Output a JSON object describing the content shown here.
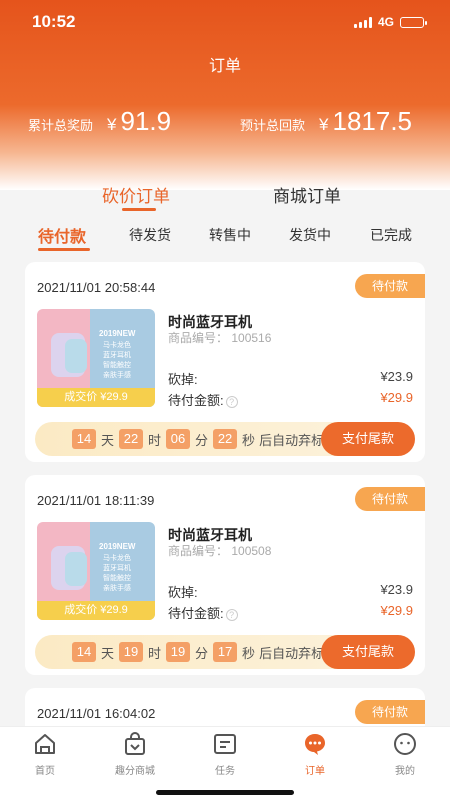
{
  "status_bar": {
    "time": "10:52",
    "network": "4G"
  },
  "header": {
    "title": "订单",
    "stats": [
      {
        "label": "累计总奖励",
        "currency": "¥",
        "value": "91.9"
      },
      {
        "label": "预计总回款",
        "currency": "¥",
        "value": "1817.5"
      }
    ]
  },
  "main_tabs": [
    {
      "label": "砍价订单",
      "active": true
    },
    {
      "label": "商城订单",
      "active": false
    }
  ],
  "sub_tabs": [
    {
      "label": "待付款",
      "active": true
    },
    {
      "label": "待发货",
      "active": false
    },
    {
      "label": "转售中",
      "active": false
    },
    {
      "label": "发货中",
      "active": false
    },
    {
      "label": "已完成",
      "active": false
    }
  ],
  "orders": [
    {
      "date": "2021/11/01 20:58:44",
      "status": "待付款",
      "image": {
        "brand": "2019NEW",
        "desc": [
          "马卡龙色",
          "蓝牙耳机",
          "智能触控",
          "亲肤手感"
        ],
        "price_label": "成交价 ¥29.9"
      },
      "name": "时尚蓝牙耳机",
      "code_label": "商品编号：",
      "code": "100516",
      "cut_label": "砍掉:",
      "cut_value": "¥23.9",
      "pay_label": "待付金额:",
      "pay_value": "¥29.9",
      "countdown": {
        "days": "14",
        "hours": "22",
        "minutes": "06",
        "seconds": "22",
        "d": "天",
        "h": "时",
        "m": "分",
        "s": "秒",
        "suffix": "后自动弃标"
      },
      "button": "支付尾款"
    },
    {
      "date": "2021/11/01 18:11:39",
      "status": "待付款",
      "image": {
        "brand": "2019NEW",
        "desc": [
          "马卡龙色",
          "蓝牙耳机",
          "智能触控",
          "亲肤手感"
        ],
        "price_label": "成交价 ¥29.9"
      },
      "name": "时尚蓝牙耳机",
      "code_label": "商品编号：",
      "code": "100508",
      "cut_label": "砍掉:",
      "cut_value": "¥23.9",
      "pay_label": "待付金额:",
      "pay_value": "¥29.9",
      "countdown": {
        "days": "14",
        "hours": "19",
        "minutes": "19",
        "seconds": "17",
        "d": "天",
        "h": "时",
        "m": "分",
        "s": "秒",
        "suffix": "后自动弃标"
      },
      "button": "支付尾款"
    },
    {
      "date": "2021/11/01 16:04:02",
      "status": "待付款"
    }
  ],
  "tabbar": [
    {
      "label": "首页",
      "icon": "home-icon",
      "active": false
    },
    {
      "label": "趣分商城",
      "icon": "shopping-bag-icon",
      "active": false
    },
    {
      "label": "任务",
      "icon": "task-icon",
      "active": false
    },
    {
      "label": "订单",
      "icon": "order-chat-icon",
      "active": true
    },
    {
      "label": "我的",
      "icon": "profile-icon",
      "active": false
    }
  ],
  "colors": {
    "accent": "#e9652a",
    "badge": "#f7a650",
    "header": "#e5541c"
  }
}
